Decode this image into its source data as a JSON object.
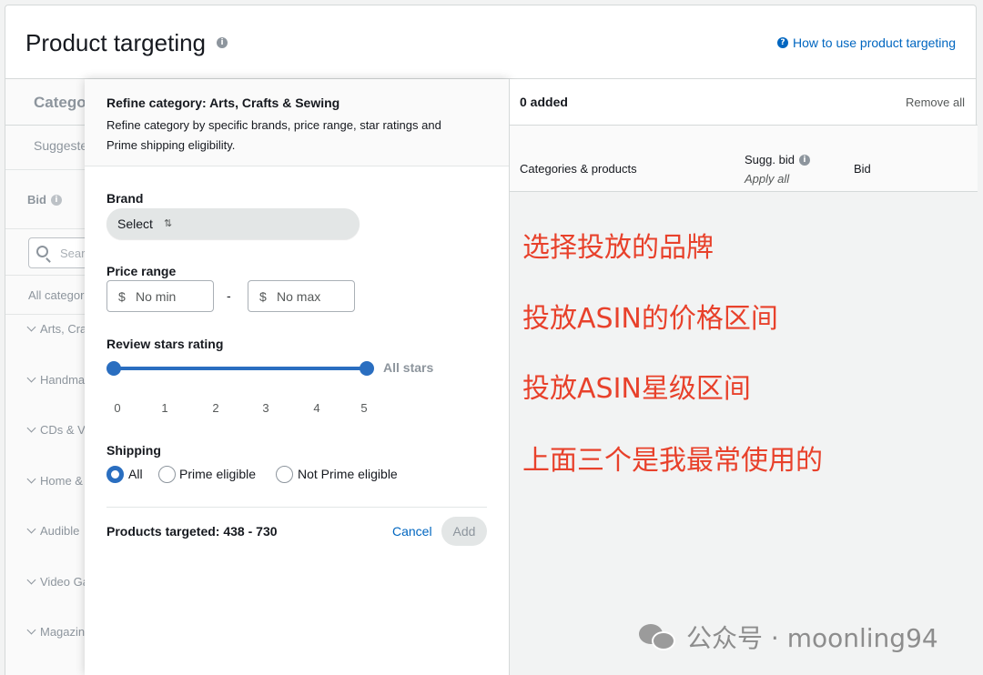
{
  "header": {
    "title": "Product targeting",
    "help_link": "How to use product targeting"
  },
  "left": {
    "tab": "Categories",
    "suggested": "Suggested",
    "bid_label": "Bid",
    "search_placeholder": "Search categories",
    "all_categories": "All categories",
    "items": [
      "Arts, Crafts",
      "Handmade",
      "CDs & Vinyl",
      "Home & Kitchen",
      "Audible",
      "Video Games",
      "Magazines"
    ]
  },
  "panel": {
    "title": "Refine category: Arts, Crafts & Sewing",
    "description": "Refine category by specific brands, price range, star ratings and Prime shipping eligibility.",
    "brand_label": "Brand",
    "brand_select": "Select",
    "price_label": "Price range",
    "currency": "$",
    "price_min_placeholder": "No min",
    "price_max_placeholder": "No max",
    "price_dash": "-",
    "rating_label": "Review stars rating",
    "rating_value": "All stars",
    "rating_range": [
      0,
      5
    ],
    "ticks": [
      "0",
      "1",
      "2",
      "3",
      "4",
      "5"
    ],
    "shipping_label": "Shipping",
    "shipping_options": [
      "All",
      "Prime eligible",
      "Not Prime eligible"
    ],
    "shipping_selected": "All",
    "products_targeted": "Products targeted: 438 - 730",
    "cancel": "Cancel",
    "add": "Add"
  },
  "right": {
    "added": "0 added",
    "remove_all": "Remove all",
    "col_categories": "Categories & products",
    "col_sugg_bid": "Sugg. bid",
    "col_apply_all": "Apply all",
    "col_bid": "Bid"
  },
  "annotations": [
    "选择投放的品牌",
    "投放ASIN的价格区间",
    "投放ASIN星级区间",
    "上面三个是我最常使用的"
  ],
  "watermark": "公众号 · moonling94",
  "colors": {
    "link": "#0066c0",
    "accent": "#2a6ec0",
    "annotation": "#e8412b"
  }
}
